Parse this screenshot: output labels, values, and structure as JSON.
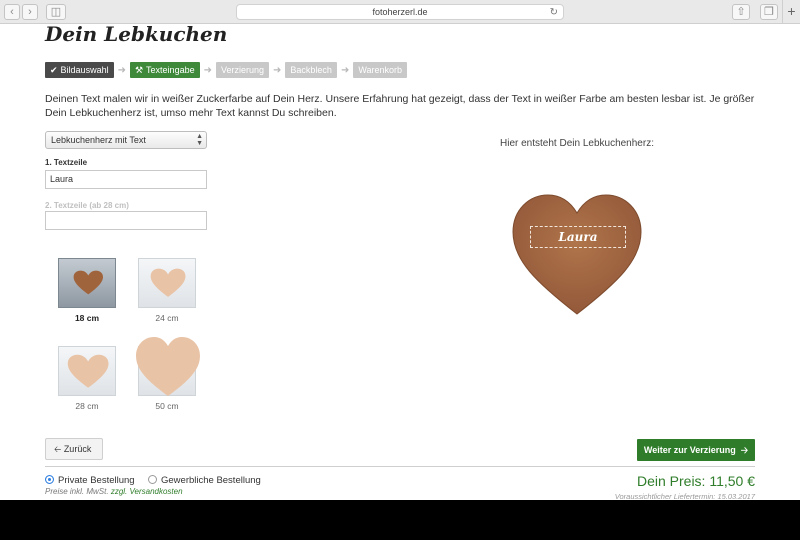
{
  "browser": {
    "url": "fotoherzerl.de"
  },
  "page": {
    "title": "Dein Lebkuchen",
    "steps": [
      {
        "label": "Bildauswahl",
        "state": "done"
      },
      {
        "label": "Texteingabe",
        "state": "active"
      },
      {
        "label": "Verzierung",
        "state": "pending"
      },
      {
        "label": "Backblech",
        "state": "pending"
      },
      {
        "label": "Warenkorb",
        "state": "pending"
      }
    ],
    "intro": "Deinen Text malen wir in weißer Zuckerfarbe auf Dein Herz. Unsere Erfahrung hat gezeigt, dass der Text in weißer Farbe am besten lesbar ist. Je größer Dein Lebkuchenherz ist, umso mehr Text kannst Du schreiben.",
    "select_value": "Lebkuchenherz mit Text",
    "line1_label": "1. Textzeile",
    "line1_value": "Laura",
    "line2_label": "2. Textzeile (ab 28 cm)",
    "line2_value": "",
    "sizes": [
      {
        "label": "18 cm",
        "selected": true
      },
      {
        "label": "24 cm",
        "selected": false
      },
      {
        "label": "28 cm",
        "selected": false
      },
      {
        "label": "50 cm",
        "selected": false
      }
    ],
    "preview_label": "Hier entsteht Dein Lebkuchenherz:",
    "heart_text": "Laura",
    "back_label": "Zurück",
    "next_label": "Weiter zur Verzierung",
    "radio_private": "Private Bestellung",
    "radio_business": "Gewerbliche Bestellung",
    "tax_text": "Preise inkl. MwSt.",
    "shipping_link": "zzgl. Versandkosten",
    "price": "Dein Preis: 11,50 €",
    "delivery": "Voraussichtlicher Liefertermin: 15.03.2017"
  },
  "colors": {
    "accent_green": "#2f7d2a",
    "gingerbread": "#a0643c",
    "heart_light": "#e9c3a6"
  }
}
